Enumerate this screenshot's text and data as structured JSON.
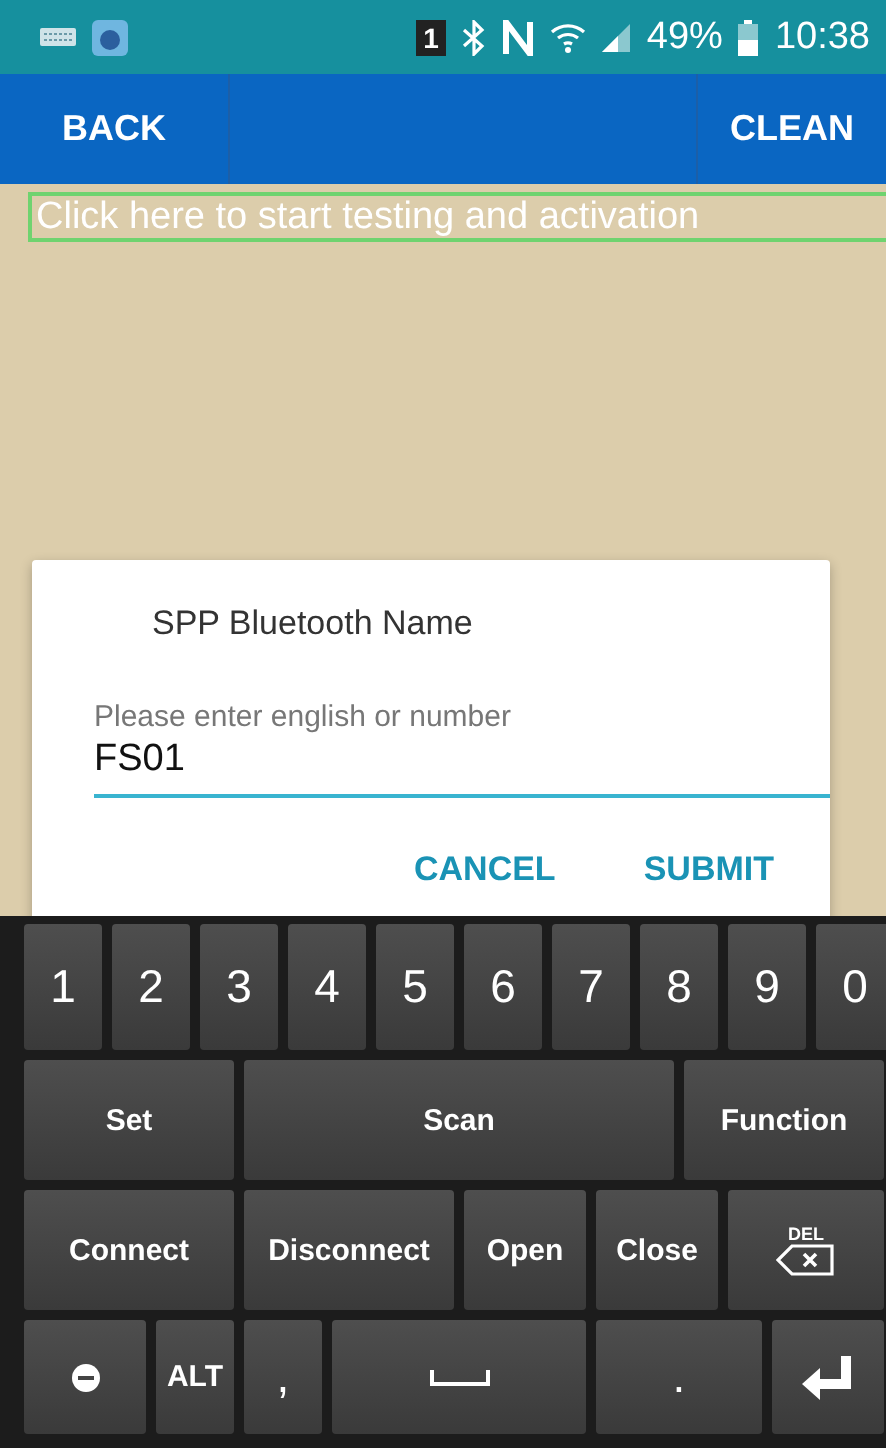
{
  "status_bar": {
    "sim": "1",
    "battery_text": "49%",
    "time": "10:38"
  },
  "app_bar": {
    "back": "BACK",
    "clean": "CLEAN"
  },
  "activation_field": {
    "placeholder": "Click here to start testing and activation"
  },
  "dialog": {
    "title": "SPP Bluetooth Name",
    "label": "Please enter english or number",
    "value": "FS01",
    "buttons": [
      "CANCEL",
      "SUBMIT"
    ]
  },
  "keyboard": {
    "rows": [
      {
        "keys": [
          {
            "kind": "char",
            "label": "1"
          },
          {
            "kind": "char",
            "label": "2"
          },
          {
            "kind": "char",
            "label": "3"
          },
          {
            "kind": "char",
            "label": "4"
          },
          {
            "kind": "char",
            "label": "5"
          },
          {
            "kind": "char",
            "label": "6"
          },
          {
            "kind": "char",
            "label": "7"
          },
          {
            "kind": "char",
            "label": "8"
          },
          {
            "kind": "char",
            "label": "9"
          },
          {
            "kind": "char",
            "label": "0"
          }
        ]
      },
      {
        "keys": [
          {
            "kind": "word",
            "label": "Set"
          },
          {
            "kind": "word",
            "label": "Scan"
          },
          {
            "kind": "word",
            "label": "Function"
          }
        ]
      },
      {
        "keys": [
          {
            "kind": "word",
            "label": "Connect"
          },
          {
            "kind": "word",
            "label": "Disconnect"
          },
          {
            "kind": "word",
            "label": "Open"
          },
          {
            "kind": "word",
            "label": "Close"
          },
          {
            "kind": "delete",
            "label": "DEL"
          }
        ]
      },
      {
        "keys": [
          {
            "kind": "symbol"
          },
          {
            "kind": "word",
            "label": "ALT"
          },
          {
            "kind": "char",
            "label": ","
          },
          {
            "kind": "space"
          },
          {
            "kind": "char",
            "label": "."
          },
          {
            "kind": "enter"
          }
        ]
      }
    ]
  }
}
